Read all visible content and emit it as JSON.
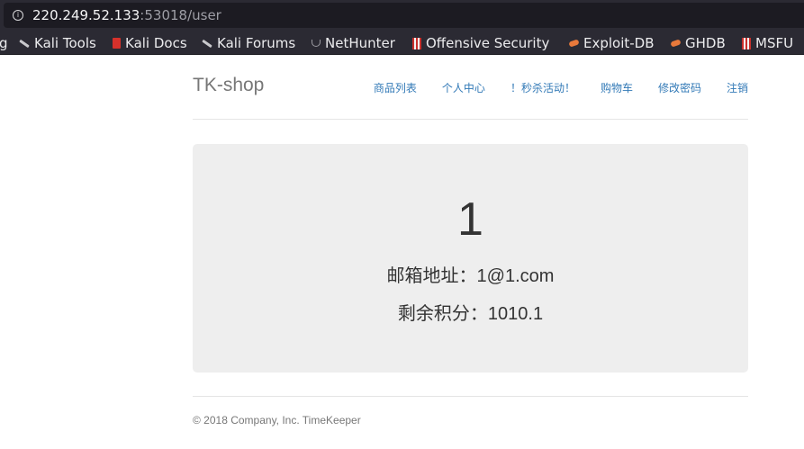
{
  "browser": {
    "url_host": "220.249.52.133",
    "url_rest": ":53018/user",
    "bookmarks": [
      {
        "label": "g",
        "icon": "none"
      },
      {
        "label": "Kali Tools",
        "icon": "kali-dragon-icon"
      },
      {
        "label": "Kali Docs",
        "icon": "kali-docs-icon"
      },
      {
        "label": "Kali Forums",
        "icon": "kali-dragon-icon"
      },
      {
        "label": "NetHunter",
        "icon": "nethunter-icon"
      },
      {
        "label": "Offensive Security",
        "icon": "offsec-icon"
      },
      {
        "label": "Exploit-DB",
        "icon": "exploitdb-icon"
      },
      {
        "label": "GHDB",
        "icon": "exploitdb-icon"
      },
      {
        "label": "MSFU",
        "icon": "offsec-icon"
      }
    ]
  },
  "site": {
    "brand": "TK-shop",
    "nav": [
      "商品列表",
      "个人中心",
      "！秒杀活动！",
      "购物车",
      "修改密码",
      "注销"
    ]
  },
  "user": {
    "name": "1",
    "email_line": "邮箱地址：1@1.com",
    "points_line": "剩余积分：1010.1"
  },
  "footer": {
    "text": "© 2018 Company, Inc. TimeKeeper"
  },
  "colors": {
    "link": "#337ab7",
    "jumbotron_bg": "#eeeeee",
    "browser_chrome": "#2b2a33"
  }
}
